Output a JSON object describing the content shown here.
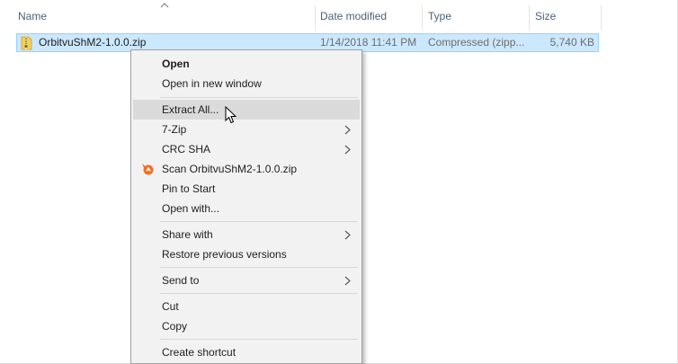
{
  "columns": {
    "name": "Name",
    "date": "Date modified",
    "type": "Type",
    "size": "Size"
  },
  "file": {
    "name": "OrbitvuShM2-1.0.0.zip",
    "date": "1/14/2018 11:41 PM",
    "type": "Compressed (zipp...",
    "size": "5,740 KB",
    "icon": "zip-folder-icon"
  },
  "menu": {
    "open": "Open",
    "open_new_window": "Open in new window",
    "extract_all": "Extract All...",
    "seven_zip": "7-Zip",
    "crc_sha": "CRC SHA",
    "scan": "Scan OrbitvuShM2-1.0.0.zip",
    "pin_to_start": "Pin to Start",
    "open_with": "Open with...",
    "share_with": "Share with",
    "restore_previous": "Restore previous versions",
    "send_to": "Send to",
    "cut": "Cut",
    "copy": "Copy",
    "create_shortcut": "Create shortcut"
  },
  "colors": {
    "selection_bg": "#cce8ff",
    "selection_border": "#99d1ff",
    "menu_bg": "#f2f2f2",
    "menu_hover": "#dadada",
    "avast_orange": "#f36f21"
  }
}
